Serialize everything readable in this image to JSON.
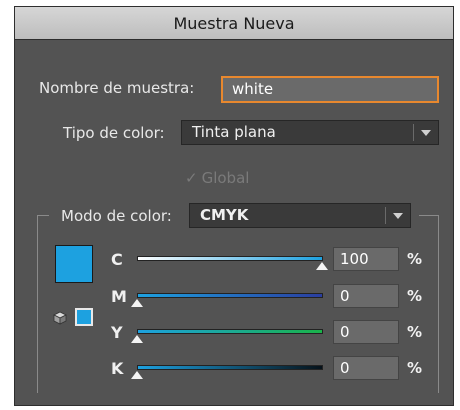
{
  "dialog": {
    "title": "Muestra Nueva",
    "swatch_name_label": "Nombre de muestra:",
    "swatch_name_value": "white",
    "color_type_label": "Tipo de color:",
    "color_type_value": "Tinta plana",
    "global_label": "Global",
    "color_mode_label": "Modo de color:",
    "color_mode_value": "CMYK",
    "swatch_color": "#1da1e0",
    "percent_sign": "%",
    "channels": [
      {
        "letter": "C",
        "value": "100"
      },
      {
        "letter": "M",
        "value": "0"
      },
      {
        "letter": "Y",
        "value": "0"
      },
      {
        "letter": "K",
        "value": "0"
      }
    ]
  }
}
